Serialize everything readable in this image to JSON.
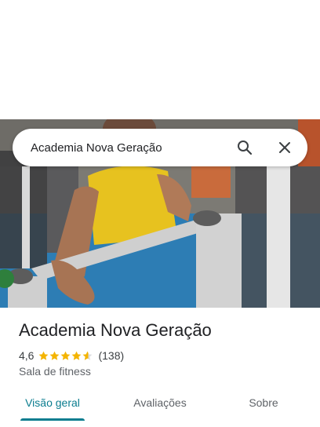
{
  "search": {
    "query": "Academia Nova Geração",
    "search_icon": "search-icon",
    "close_icon": "close-icon"
  },
  "place": {
    "name": "Academia Nova Geração",
    "rating": "4,6",
    "rating_stars_value": 4.6,
    "reviews_count": "(138)",
    "category": "Sala de fitness"
  },
  "tabs": [
    {
      "label": "Visão geral",
      "active": true
    },
    {
      "label": "Avaliações",
      "active": false
    },
    {
      "label": "Sobre",
      "active": false
    }
  ],
  "colors": {
    "accent": "#0b7d8f",
    "star": "#f4b400",
    "text_primary": "#202124",
    "text_secondary": "#5f6368"
  }
}
